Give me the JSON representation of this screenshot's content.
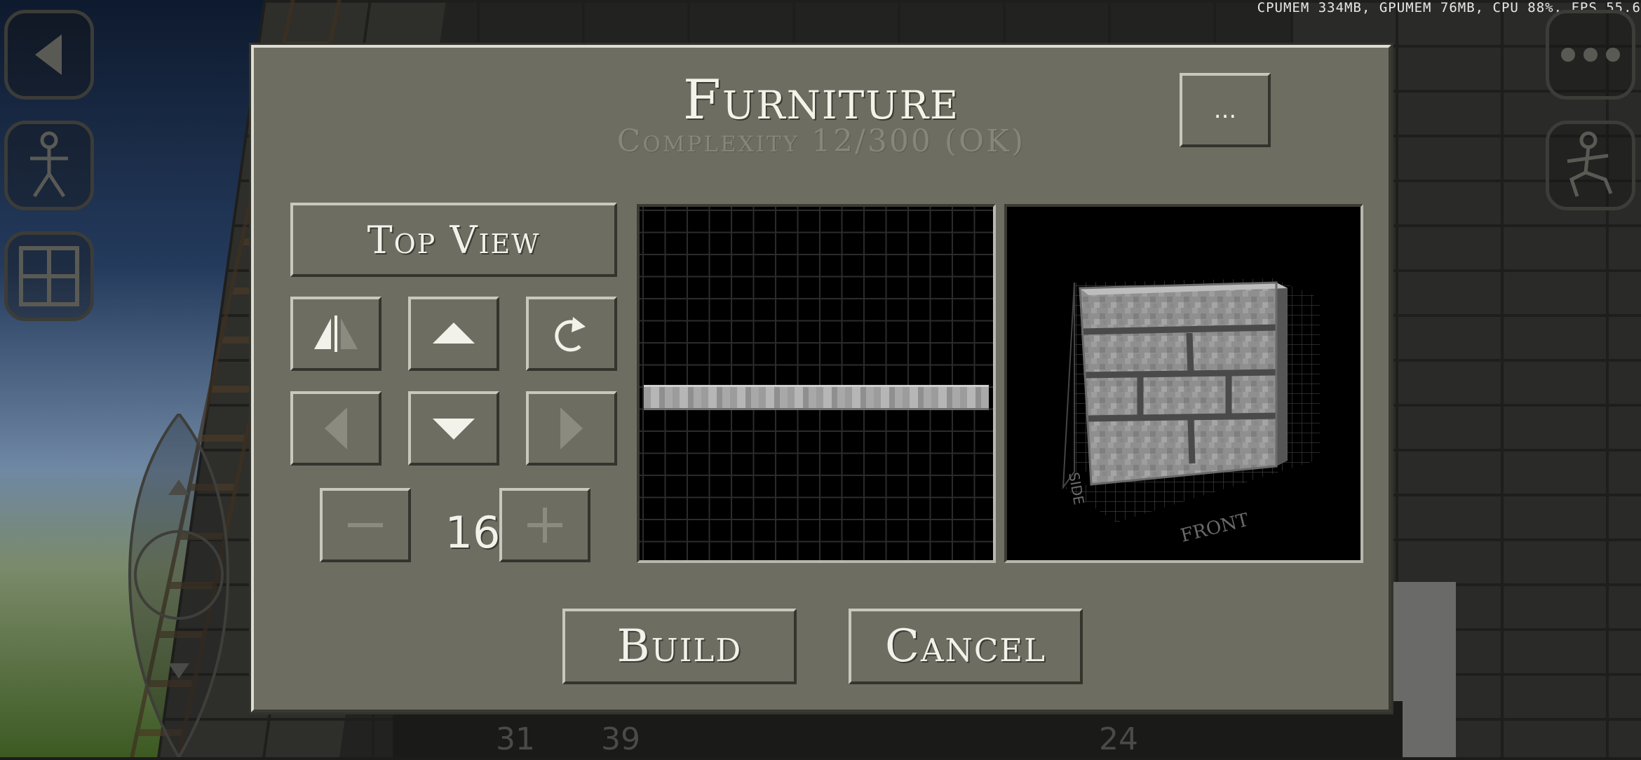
{
  "hud": {
    "stats": "CPUMEM 334MB, GPUMEM 76MB, CPU 88%, FPS 55.6"
  },
  "hotbar": {
    "slots": [
      "31",
      "39",
      "24"
    ]
  },
  "dialog": {
    "title": "Furniture",
    "subtitle": "Complexity 12/300 (OK)",
    "more_label": "...",
    "view_mode_label": "Top View",
    "resolution": "16",
    "build_label": "Build",
    "cancel_label": "Cancel",
    "preview_labels": {
      "side": "SIDE",
      "front": "FRONT"
    }
  },
  "icons": {
    "mirror": "mirror-icon",
    "up": "arrow-up-icon",
    "rotate": "rotate-icon",
    "left": "arrow-left-icon",
    "down": "arrow-down-icon",
    "right": "arrow-right-icon",
    "minus": "minus-icon",
    "plus": "plus-icon"
  },
  "colors": {
    "dialog_bg": "#6e6d62",
    "text": "#f2f2ea",
    "disabled_text": "#8c8b80",
    "subtitle": "#87867b"
  }
}
